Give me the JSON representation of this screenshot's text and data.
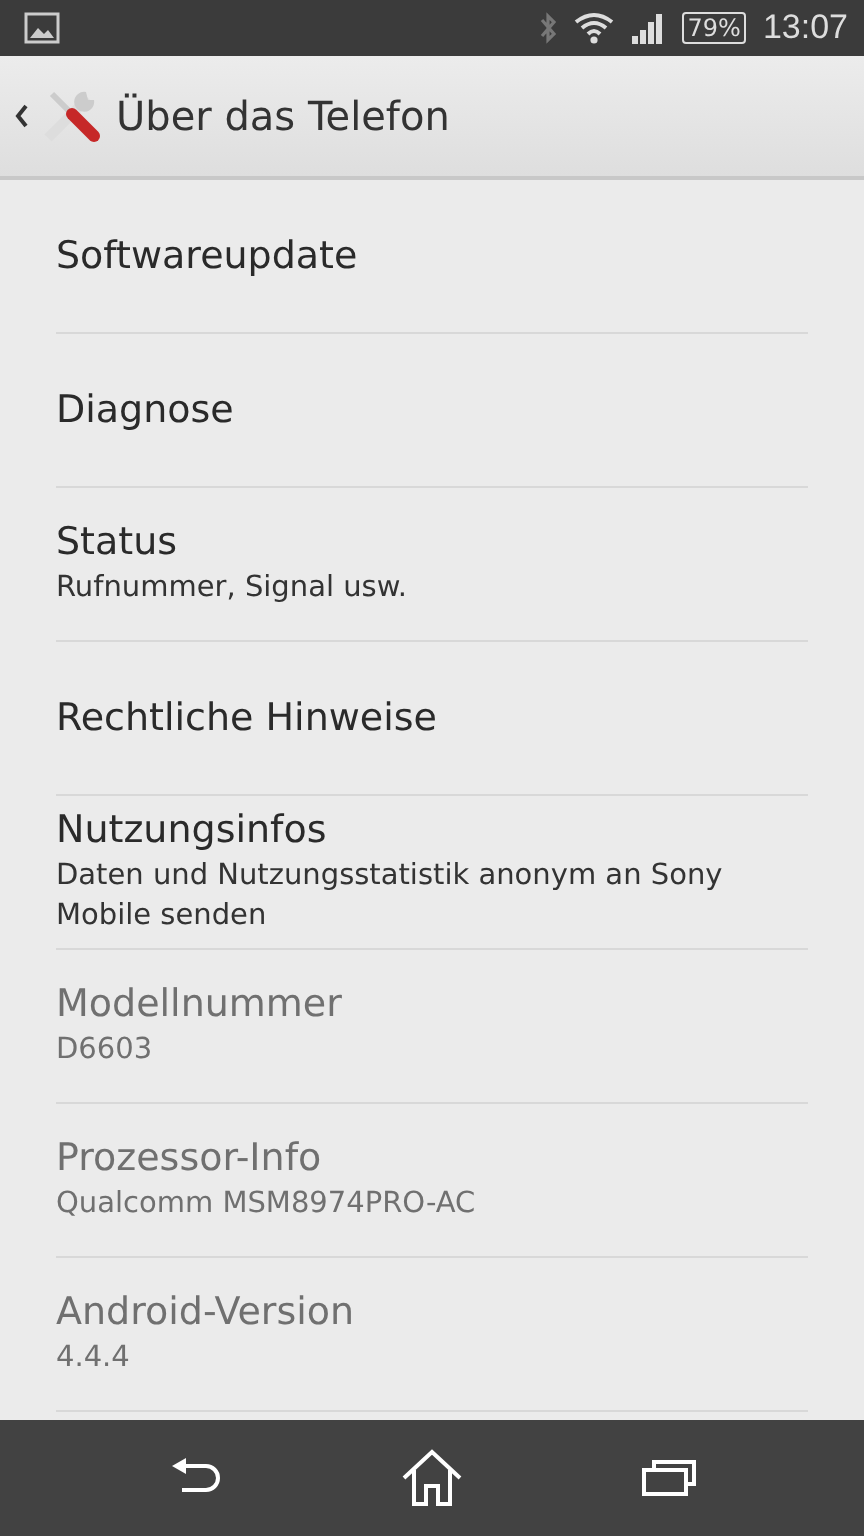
{
  "status_bar": {
    "battery": "79%",
    "time": "13:07"
  },
  "action_bar": {
    "title": "Über das Telefon"
  },
  "items": [
    {
      "title": "Softwareupdate",
      "disabled": false
    },
    {
      "title": "Diagnose",
      "disabled": false
    },
    {
      "title": "Status",
      "summary": "Rufnummer, Signal usw.",
      "disabled": false
    },
    {
      "title": "Rechtliche Hinweise",
      "disabled": false
    },
    {
      "title": "Nutzungsinfos",
      "summary": "Daten und Nutzungsstatistik anonym an Sony Mobile senden",
      "disabled": false
    },
    {
      "title": "Modellnummer",
      "summary": "D6603",
      "disabled": true
    },
    {
      "title": "Prozessor-Info",
      "summary": "Qualcomm MSM8974PRO-AC",
      "disabled": true
    },
    {
      "title": "Android-Version",
      "summary": "4.4.4",
      "disabled": true
    }
  ]
}
